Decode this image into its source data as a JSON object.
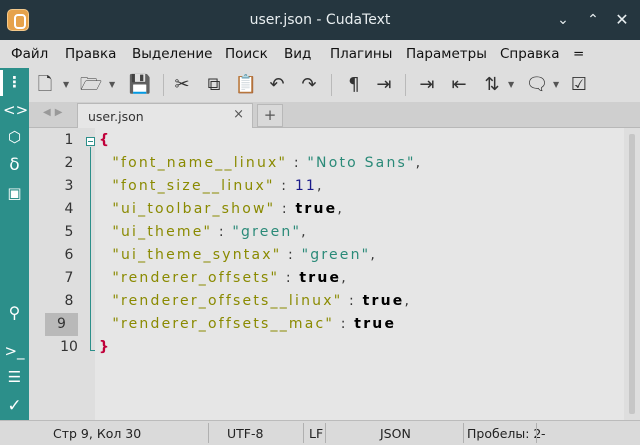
{
  "window": {
    "title": "user.json - CudaText"
  },
  "menu": [
    "Файл",
    "Правка",
    "Выделение",
    "Поиск",
    "Вид",
    "Плагины",
    "Параметры",
    "Справка",
    "="
  ],
  "tabs": [
    {
      "label": "user.json",
      "close": "×"
    }
  ],
  "tab_add": "+",
  "editor": {
    "line_numbers": [
      "1",
      "2",
      "3",
      "4",
      "5",
      "6",
      "7",
      "8",
      "9",
      "10"
    ],
    "current_line": 9,
    "lines": [
      [
        {
          "t": "{",
          "c": "brace"
        }
      ],
      [
        {
          "t": "  ",
          "c": "p"
        },
        {
          "t": "\"font_name__linux\"",
          "c": "k"
        },
        {
          "t": " : ",
          "c": "p"
        },
        {
          "t": "\"Noto Sans\"",
          "c": "s"
        },
        {
          "t": ",",
          "c": "p"
        }
      ],
      [
        {
          "t": "  ",
          "c": "p"
        },
        {
          "t": "\"font_size__linux\"",
          "c": "k"
        },
        {
          "t": " : ",
          "c": "p"
        },
        {
          "t": "11",
          "c": "n"
        },
        {
          "t": ",",
          "c": "p"
        }
      ],
      [
        {
          "t": "  ",
          "c": "p"
        },
        {
          "t": "\"ui_toolbar_show\"",
          "c": "k"
        },
        {
          "t": " : ",
          "c": "p"
        },
        {
          "t": "true",
          "c": "b"
        },
        {
          "t": ",",
          "c": "p"
        }
      ],
      [
        {
          "t": "  ",
          "c": "p"
        },
        {
          "t": "\"ui_theme\"",
          "c": "k"
        },
        {
          "t": " : ",
          "c": "p"
        },
        {
          "t": "\"green\"",
          "c": "s"
        },
        {
          "t": ",",
          "c": "p"
        }
      ],
      [
        {
          "t": "  ",
          "c": "p"
        },
        {
          "t": "\"ui_theme_syntax\"",
          "c": "k"
        },
        {
          "t": " : ",
          "c": "p"
        },
        {
          "t": "\"green\"",
          "c": "s"
        },
        {
          "t": ",",
          "c": "p"
        }
      ],
      [
        {
          "t": "  ",
          "c": "p"
        },
        {
          "t": "\"renderer_offsets\"",
          "c": "k"
        },
        {
          "t": " : ",
          "c": "p"
        },
        {
          "t": "true",
          "c": "b"
        },
        {
          "t": ",",
          "c": "p"
        }
      ],
      [
        {
          "t": "  ",
          "c": "p"
        },
        {
          "t": "\"renderer_offsets__linux\"",
          "c": "k"
        },
        {
          "t": " : ",
          "c": "p"
        },
        {
          "t": "true",
          "c": "b"
        },
        {
          "t": ",",
          "c": "p"
        }
      ],
      [
        {
          "t": "  ",
          "c": "p"
        },
        {
          "t": "\"renderer_offsets__mac\"",
          "c": "k"
        },
        {
          "t": " : ",
          "c": "p"
        },
        {
          "t": "true",
          "c": "b"
        }
      ],
      [
        {
          "t": "}",
          "c": "brace"
        }
      ]
    ]
  },
  "status": {
    "position": "Стр 9, Кол 30",
    "encoding": "UTF-8",
    "line_ends": "LF",
    "lexer": "JSON",
    "indent": "Пробелы: 2",
    "extra": "-"
  },
  "colors": {
    "accent": "#2c8f8a",
    "titlebar": "#25363f"
  }
}
